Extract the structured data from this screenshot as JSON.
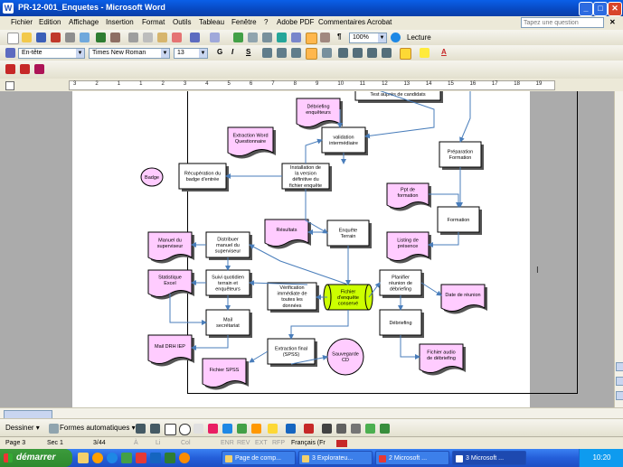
{
  "window": {
    "title": "PR-12-001_Enquetes - Microsoft Word",
    "app_letter": "W",
    "btn_min": "_",
    "btn_max": "□",
    "btn_close": "✕"
  },
  "menu": {
    "items": [
      "Fichier",
      "Edition",
      "Affichage",
      "Insertion",
      "Format",
      "Outils",
      "Tableau",
      "Fenêtre",
      "?",
      "Adobe PDF",
      "Commentaires Acrobat"
    ],
    "ask_placeholder": "Tapez une question",
    "ask_close": "✕"
  },
  "toolbar_standard": {
    "zoom": "100%",
    "lecture_label": "Lecture",
    "paragraph_mark": "¶"
  },
  "toolbar_format": {
    "style": "En-tête",
    "font": "Times New Roman",
    "size": "13",
    "bold": "G",
    "italic": "I",
    "underline": "S",
    "font_color_label": "A"
  },
  "ruler": {
    "numbers": [
      "3",
      "2",
      "1",
      "1",
      "2",
      "3",
      "4",
      "5",
      "6",
      "7",
      "8",
      "9",
      "10",
      "11",
      "12",
      "13",
      "14",
      "15",
      "16",
      "17",
      "18",
      "19"
    ]
  },
  "diagram": {
    "nodes": {
      "test": "Test auprès de candidats",
      "debriefing_enq": "Débriefing enquêteurs",
      "validation": "validation intermédiaire",
      "extraction_word": "Extraction Word Questionnaire",
      "preparation": "Préparation Formation",
      "badge": "Badge",
      "recup": "Récupération du badge d'entrée",
      "install": "Installation de la version définitive du fichier enquête",
      "ppt": "Ppt de formation",
      "formation": "Formation",
      "resultats": "Résultats",
      "enquete": "Enquête Terrain",
      "listing": "Listing de présence",
      "manuel_sup": "Manuel du superviseur",
      "distribuer": "Distribuer manuel du superviseur",
      "statistique": "Statistique Excel",
      "suivi": "Suivi quotidien terrain et enquêteurs",
      "verification": "Vérification immédiate de toutes les données",
      "fichier": "Fichier d'enquête conservé",
      "planifier": "Planifier réunion de débriefing",
      "date": "Date de réunion",
      "mail_sec": "Mail secrétariat",
      "debriefing": "Débriefing",
      "mail_drh": "Mail DRH IEP",
      "extraction_final": "Extraction final (SPSS)",
      "sauvegarde": "Sauvegarde CD",
      "fichier_spss": "Fichier SPSS",
      "fichier_audio": "Fichier audio de débriefing"
    }
  },
  "drawing_toolbar": {
    "dessiner": "Dessiner ▾",
    "formes": "Formes automatiques ▾"
  },
  "status": {
    "page": "Page 3",
    "sec": "Sec 1",
    "pages": "3/44",
    "at": "À",
    "li": "Li",
    "col": "Col",
    "enr": "ENR",
    "rev": "REV",
    "ext": "EXT",
    "rfp": "RFP",
    "lang": "Français (Fr"
  },
  "taskbar": {
    "start": "démarrer",
    "tasks": [
      "Page de comp...",
      "3 Explorateu...",
      "2 Microsoft ...",
      "3 Microsoft ..."
    ],
    "clock": "10:20"
  },
  "colors": {
    "pink": "#FFCCFF",
    "green": "#CCFF00",
    "arrow": "#4A7EBB",
    "title_blue": "#0A5FE8"
  }
}
